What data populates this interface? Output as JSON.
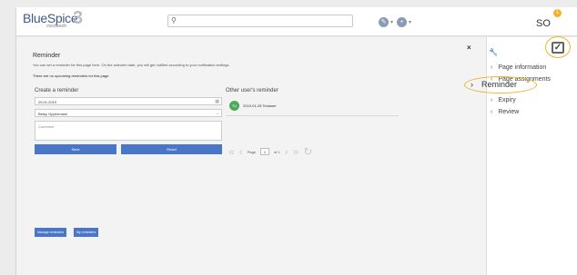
{
  "header": {
    "logo_main": "BlueSpice",
    "logo_number": "3",
    "logo_sub": "mediawiki",
    "search_icon": "search-icon",
    "tool1_icon": "pencil-icon",
    "tool2_icon": "plus-icon",
    "user_initials": "SO",
    "notification_count": "1"
  },
  "main": {
    "title": "Reminder",
    "description": "You can set a reminder for this page here. On the selected date, you will get notified according to your notification settings.",
    "notice": "There are no upcoming reminders for this page.",
    "close_label": "×",
    "create_heading": "Create a reminder",
    "date_value": "29.01.2019",
    "user_value": "Betsy Oppermann",
    "comment_placeholder": "Comment",
    "save_label": "Save",
    "reset_label": "Reset",
    "other_heading": "Other user's reminder",
    "other_reminder": {
      "initials": "TU",
      "text": "2019-01-28 Testuser"
    },
    "pager": {
      "page_label": "Page",
      "page_value": "1",
      "of_label": "of 1"
    },
    "manage_label": "Manage reminders",
    "my_label": "My reminders"
  },
  "sidebar": {
    "items": [
      {
        "label": "Page information"
      },
      {
        "label": "Page assignments"
      },
      {
        "label": "Reminder"
      },
      {
        "label": "Expiry"
      },
      {
        "label": "Review"
      }
    ]
  },
  "colors": {
    "accent": "#4a76c8",
    "highlight": "#f0b429",
    "avatar": "#4caa5a"
  }
}
